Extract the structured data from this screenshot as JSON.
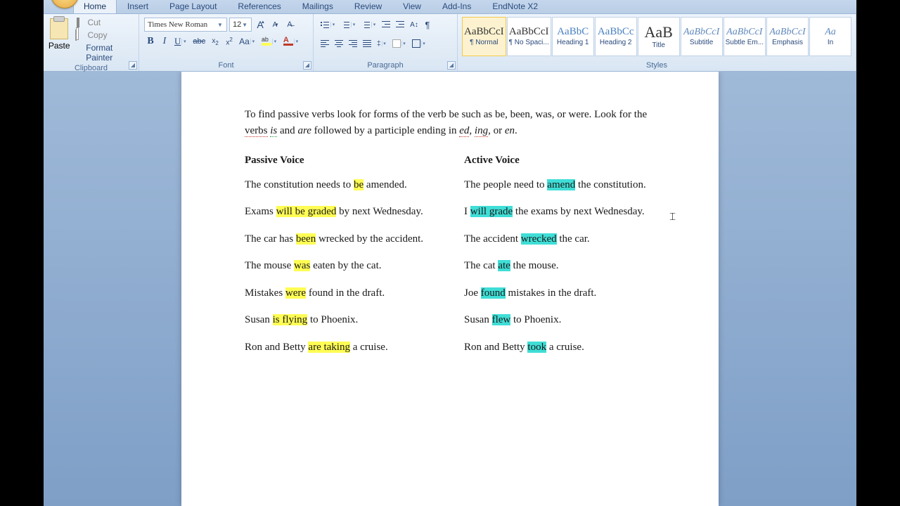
{
  "tabs": [
    "Home",
    "Insert",
    "Page Layout",
    "References",
    "Mailings",
    "Review",
    "View",
    "Add-Ins",
    "EndNote X2"
  ],
  "active_tab": 0,
  "clipboard": {
    "paste": "Paste",
    "cut": "Cut",
    "copy": "Copy",
    "format_painter": "Format Painter",
    "label": "Clipboard"
  },
  "font": {
    "name": "Times New Roman",
    "size": "12",
    "label": "Font"
  },
  "paragraph": {
    "label": "Paragraph"
  },
  "styles": {
    "label": "Styles",
    "items": [
      {
        "preview": "AaBbCcI",
        "label": "¶ Normal",
        "cls": "",
        "sel": true
      },
      {
        "preview": "AaBbCcI",
        "label": "¶ No Spaci...",
        "cls": ""
      },
      {
        "preview": "AaBbC",
        "label": "Heading 1",
        "cls": "blue"
      },
      {
        "preview": "AaBbCc",
        "label": "Heading 2",
        "cls": "blue"
      },
      {
        "preview": "AaB",
        "label": "Title",
        "cls": "big"
      },
      {
        "preview": "AaBbCcI",
        "label": "Subtitle",
        "cls": "ital"
      },
      {
        "preview": "AaBbCcI",
        "label": "Subtle Em...",
        "cls": "ital"
      },
      {
        "preview": "AaBbCcI",
        "label": "Emphasis",
        "cls": "ital"
      },
      {
        "preview": "Aa",
        "label": "In",
        "cls": "ital"
      }
    ]
  },
  "doc": {
    "intro_a": "To find passive verbs look for forms of the verb be such as be, been, was, or were. Look for the ",
    "verbs": "verbs",
    "is": "is",
    "and": " and ",
    "are": "are",
    "intro_b": " followed by a participle ending in ",
    "ed": "ed",
    "comma1": ", ",
    "ing": "ing",
    "orcomma": ", or ",
    "en": "en",
    "period": ".",
    "passive_h": "Passive Voice",
    "active_h": "Active Voice",
    "p": [
      {
        "pre": "The constitution needs to ",
        "h": "be",
        "post": " amended."
      },
      {
        "pre": "Exams ",
        "h": "will be graded",
        "post": " by next Wednesday."
      },
      {
        "pre": "The car has ",
        "h": "been",
        "post": " wrecked by the accident."
      },
      {
        "pre": "The mouse ",
        "h": "was",
        "post": " eaten by the cat."
      },
      {
        "pre": "Mistakes ",
        "h": "were",
        "post": " found in the draft."
      },
      {
        "pre": "Susan ",
        "h": "is flying",
        "post": " to Phoenix."
      },
      {
        "pre": "Ron and Betty ",
        "h": "are taking",
        "post": " a cruise."
      }
    ],
    "a": [
      {
        "pre": "The people need to ",
        "h": "amend",
        "post": " the constitution."
      },
      {
        "pre": "I ",
        "h": "will grade",
        "post": " the exams by next Wednesday."
      },
      {
        "pre": "The accident ",
        "h": "wrecked",
        "post": " the car."
      },
      {
        "pre": "The cat ",
        "h": "ate",
        "post": " the mouse."
      },
      {
        "pre": "Joe ",
        "h": "found",
        "post": " mistakes in the draft."
      },
      {
        "pre": "Susan ",
        "h": "flew",
        "post": " to Phoenix."
      },
      {
        "pre": "Ron and Betty ",
        "h": "took",
        "post": " a cruise."
      }
    ]
  }
}
